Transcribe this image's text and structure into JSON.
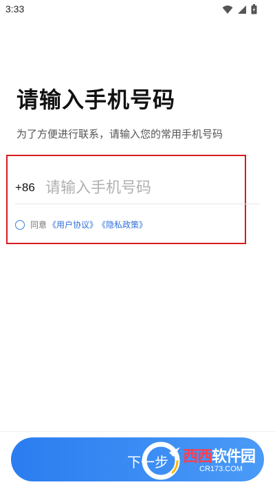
{
  "status_bar": {
    "time": "3:33"
  },
  "login": {
    "title": "请输入手机号码",
    "subtitle": "为了方便进行联系，请输入您的常用手机号码",
    "country_code": "+86",
    "phone_placeholder": "请输入手机号码",
    "phone_value": "",
    "agree": {
      "checked": false,
      "prefix": "同意",
      "user_agreement": "《用户协议》",
      "privacy_policy": "《隐私政策》"
    },
    "next_button": "下一步"
  },
  "watermark": {
    "brand": "西西软件园",
    "url": "CR173.COM"
  },
  "colors": {
    "accent": "#2b7df0",
    "link": "#2f6fd8",
    "highlight_border": "#d7191f"
  }
}
